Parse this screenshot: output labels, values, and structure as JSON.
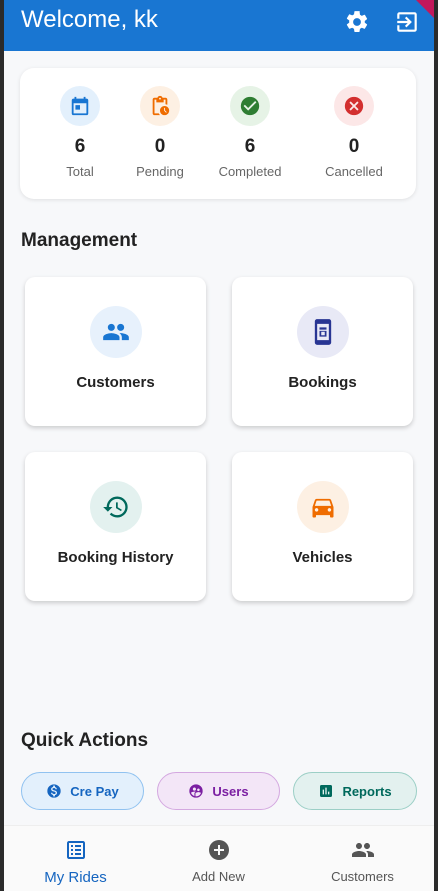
{
  "appbar": {
    "title": "Welcome, kk",
    "settings_icon": "gear-icon",
    "logout_icon": "logout-icon",
    "color": "#1976d2"
  },
  "stats": [
    {
      "value": "6",
      "label": "Total",
      "icon": "calendar-icon",
      "color": "#1976d2",
      "bg": "#e3f0fc"
    },
    {
      "value": "0",
      "label": "Pending",
      "icon": "pending-clipboard-icon",
      "color": "#ef6c00",
      "bg": "#fdf0e3"
    },
    {
      "value": "6",
      "label": "Completed",
      "icon": "check-circle-icon",
      "color": "#2e7d32",
      "bg": "#e6f3e6"
    },
    {
      "value": "0",
      "label": "Cancelled",
      "icon": "cancel-circle-icon",
      "color": "#d32f2f",
      "bg": "#fce7e7"
    }
  ],
  "management": {
    "title": "Management",
    "cards": [
      {
        "label": "Customers",
        "icon": "people-icon",
        "color": "#1976d2",
        "bg": "#e7f1fc"
      },
      {
        "label": "Bookings",
        "icon": "booking-phone-icon",
        "color": "#283593",
        "bg": "#e8e9f6"
      },
      {
        "label": "Booking History",
        "icon": "history-icon",
        "color": "#00695c",
        "bg": "#e3f1ef"
      },
      {
        "label": "Vehicles",
        "icon": "car-icon",
        "color": "#ef6c00",
        "bg": "#fdf0e3"
      }
    ]
  },
  "quick_actions": {
    "title": "Quick Actions",
    "chips": [
      {
        "label": "Cre Pay",
        "icon": "dollar-icon",
        "color": "#1565c0",
        "bg": "#e3f0fc",
        "border": "#90c2f0"
      },
      {
        "label": "Users",
        "icon": "users-group-icon",
        "color": "#7b1fa2",
        "bg": "#f3e6f7",
        "border": "#d4a8e0"
      },
      {
        "label": "Reports",
        "icon": "report-icon",
        "color": "#00695c",
        "bg": "#e3f1ef",
        "border": "#9ccfc6"
      }
    ]
  },
  "bottom_nav": [
    {
      "label": "My Rides",
      "icon": "list-icon",
      "active": true,
      "color": "#1565c0"
    },
    {
      "label": "Add New",
      "icon": "add-circle-icon",
      "active": false,
      "color": "#555555"
    },
    {
      "label": "Customers",
      "icon": "people-icon",
      "active": false,
      "color": "#555555"
    }
  ]
}
